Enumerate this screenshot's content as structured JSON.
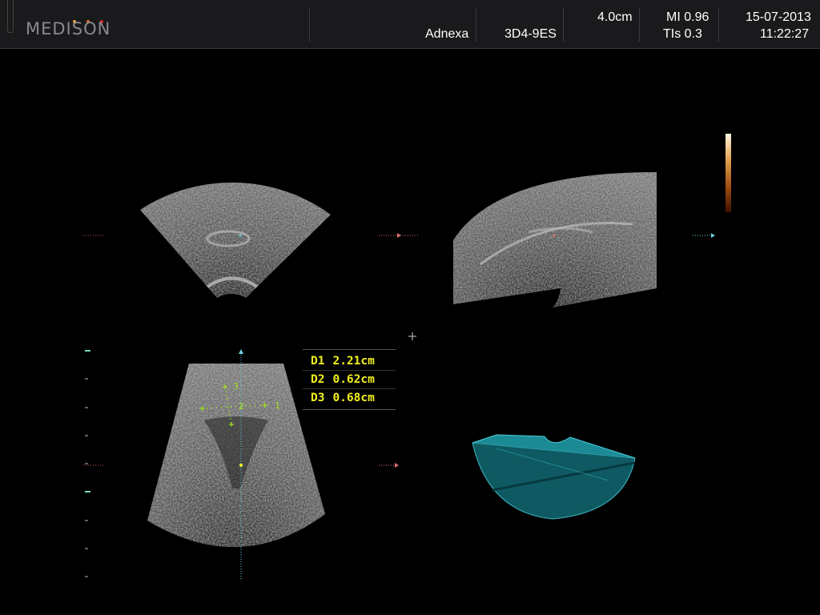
{
  "header": {
    "brand": "MEDISON",
    "preset": "Adnexa",
    "probe": "3D4-9ES",
    "depth": "4.0cm",
    "mi": "MI 0.96",
    "tis": "TIs 0.3",
    "date": "15-07-2013",
    "time": "11:22:27",
    "dot_colors": [
      "#e8a040",
      "#e07030",
      "#e02020"
    ]
  },
  "measurements": [
    {
      "label": "D1",
      "value": "2.21cm"
    },
    {
      "label": "D2",
      "value": "0.62cm"
    },
    {
      "label": "D3",
      "value": "0.68cm"
    }
  ],
  "caliper_labels": [
    "1",
    "2",
    "3"
  ],
  "colors": {
    "caliper": "#9be01e",
    "measure_text": "#f2f21e",
    "render3d": "#1c8a94"
  }
}
